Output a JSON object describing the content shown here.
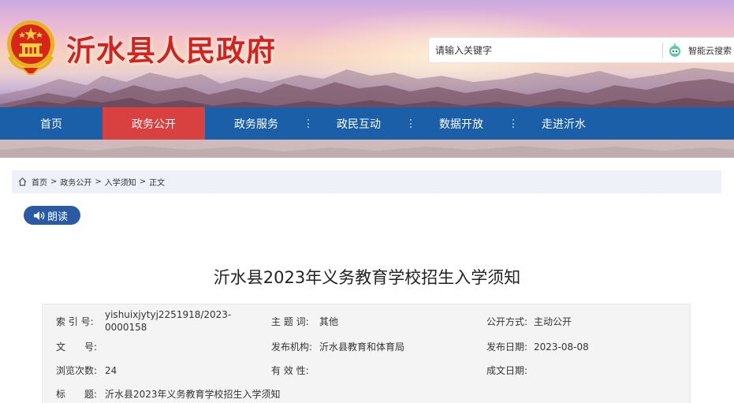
{
  "header": {
    "site_title": "沂水县人民政府",
    "search": {
      "placeholder": "请输入关键字",
      "button_label": "智能云搜索"
    }
  },
  "nav": {
    "items": [
      {
        "label": "首页",
        "active": false
      },
      {
        "label": "政务公开",
        "active": true
      },
      {
        "label": "政务服务",
        "active": false
      },
      {
        "label": "政民互动",
        "active": false
      },
      {
        "label": "数据开放",
        "active": false
      },
      {
        "label": "走进沂水",
        "active": false
      }
    ]
  },
  "breadcrumb": {
    "items": [
      "首页",
      "政务公开",
      "入学须知",
      "正文"
    ],
    "separator": ">"
  },
  "read_button": {
    "label": "朗读"
  },
  "article": {
    "title": "沂水县2023年义务教育学校招生入学须知",
    "meta": {
      "index_label": "索 引 号:",
      "index_value_line1": "yishuixjytyj2251918/2023-",
      "index_value_line2": "0000158",
      "subject_label": "主 题 词:",
      "subject_value": "其他",
      "open_mode_label": "公开方式:",
      "open_mode_value": "主动公开",
      "doc_no_label": "文　　号:",
      "doc_no_value": "",
      "publisher_label": "发布机构:",
      "publisher_value": "沂水县教育和体育局",
      "publish_date_label": "发布日期:",
      "publish_date_value": "2023-08-08",
      "views_label": "浏览次数:",
      "views_value": "24",
      "validity_label": "有 效 性:",
      "validity_value": "",
      "created_date_label": "成文日期:",
      "created_date_value": "",
      "title_label": "标　　题:",
      "title_value": "沂水县2023年义务教育学校招生入学须知"
    }
  },
  "colors": {
    "nav_bg": "#1a5fa8",
    "nav_active_bg": "#d94040",
    "title_red": "#d6221a",
    "read_btn_bg": "#2a5aa3",
    "breadcrumb_bg": "#eef1f7"
  }
}
